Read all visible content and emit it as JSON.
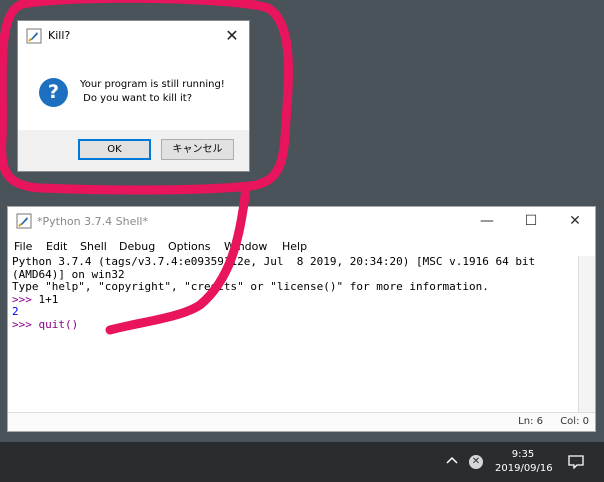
{
  "dialog": {
    "title": "Kill?",
    "close_glyph": "✕",
    "message_line1": "Your program is still running!",
    "message_line2": " Do you want to kill it?",
    "ok_label": "OK",
    "cancel_label": "キャンセル",
    "icon": "question-icon"
  },
  "shell": {
    "title": "*Python 3.7.4 Shell*",
    "menu": [
      "File",
      "Edit",
      "Shell",
      "Debug",
      "Options",
      "Window",
      "Help"
    ],
    "lines": [
      "Python 3.7.4 (tags/v3.7.4:e09359112e, Jul  8 2019, 20:34:20) [MSC v.1916 64 bit",
      "(AMD64)] on win32",
      "Type \"help\", \"copyright\", \"credits\" or \"license()\" for more information."
    ],
    "prompt1": ">>> ",
    "input1": "1+1",
    "output1": "2",
    "prompt2": ">>> ",
    "input2": "quit()",
    "status_ln": "Ln: 6",
    "status_col": "Col: 0"
  },
  "taskbar": {
    "time": "9:35",
    "date": "2019/09/16"
  },
  "colors": {
    "annotation": "#e8145c",
    "desktop": "#4a535a",
    "taskbar": "#2a2d30"
  }
}
